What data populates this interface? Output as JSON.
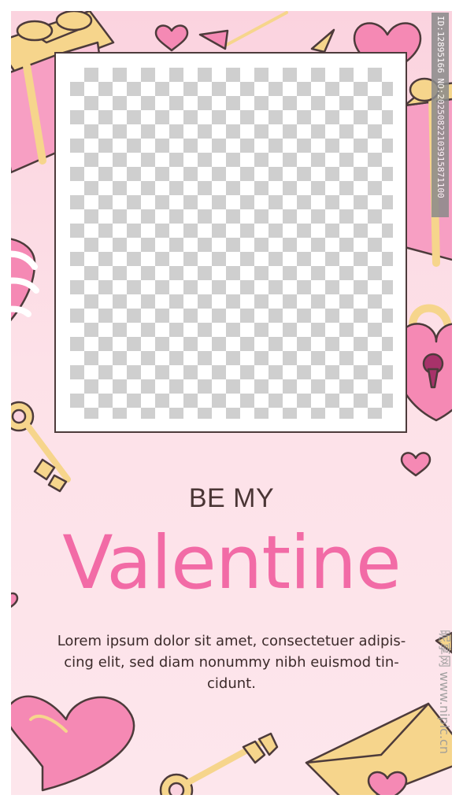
{
  "heading": {
    "small": "BE MY",
    "large": "Valentine"
  },
  "body": {
    "lines": [
      "Lorem ipsum dolor sit amet, consectetuer adipis-",
      "cing elit, sed diam nonummy nibh euismod tin-",
      "cidunt."
    ]
  },
  "watermark": {
    "id_text": "ID:12895166 NO:20250822103915871100",
    "site_text": "昵享网 www.nipic.cn"
  },
  "colors": {
    "background": "#fbd3df",
    "accent_pink": "#f26ba6",
    "heading_dark": "#4a3535",
    "gold": "#f6d58c",
    "outline": "#4d3b3b"
  }
}
